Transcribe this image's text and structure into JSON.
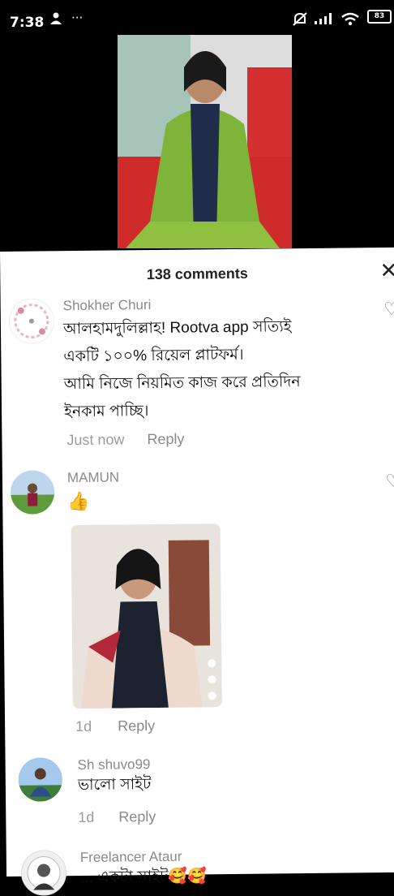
{
  "status": {
    "time": "7:38",
    "battery": "83"
  },
  "sheet": {
    "title": "138 comments"
  },
  "comments": [
    {
      "user": "Shokher Churi",
      "lines": [
        "আলহামদুলিল্লাহ! Rootva app সত্যিই",
        "একটি ১০০% রিয়েল প্লাটফর্ম।",
        "আমি নিজে নিয়মিত কাজ করে প্রতিদিন",
        "ইনকাম পাচ্ছি।"
      ],
      "time": "Just now",
      "reply": "Reply"
    },
    {
      "user": "MAMUN",
      "emoji": "👍",
      "time": "1d",
      "reply": "Reply"
    },
    {
      "user": "Sh shuvo99",
      "lines": [
        "ভালো সাইট"
      ],
      "time": "1d",
      "reply": "Reply"
    },
    {
      "user": "Freelancer Ataur",
      "lines": [
        "... একটা সাইট🥰🥰"
      ]
    }
  ]
}
